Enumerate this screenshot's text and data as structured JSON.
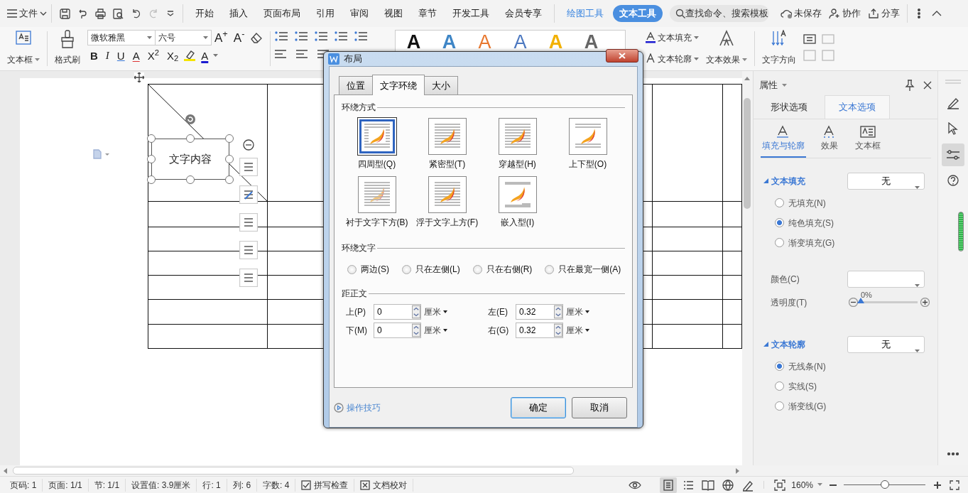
{
  "top_bar": {
    "menu_label": "文件",
    "tabs": [
      {
        "label": "开始",
        "kind": "normal",
        "selected": false
      },
      {
        "label": "插入",
        "kind": "normal",
        "selected": false
      },
      {
        "label": "页面布局",
        "kind": "normal",
        "selected": false
      },
      {
        "label": "引用",
        "kind": "normal",
        "selected": false
      },
      {
        "label": "审阅",
        "kind": "normal",
        "selected": false
      },
      {
        "label": "视图",
        "kind": "normal",
        "selected": false
      },
      {
        "label": "章节",
        "kind": "normal",
        "selected": false
      },
      {
        "label": "开发工具",
        "kind": "normal",
        "selected": false
      },
      {
        "label": "会员专享",
        "kind": "normal",
        "selected": false
      },
      {
        "label": "绘图工具",
        "kind": "context",
        "selected": false
      },
      {
        "label": "文本工具",
        "kind": "context",
        "selected": true
      }
    ],
    "search": {
      "placeholder": "查找命令、搜索模板"
    },
    "actions": [
      "未保存",
      "协作",
      "分享"
    ]
  },
  "ribbon": {
    "text_box": "文本框",
    "format_painter": "格式刷",
    "font_name": "微软雅黑",
    "font_size": "六号",
    "size_buttons": [
      "A$^{+}$",
      "A$^{-}$"
    ],
    "format_buttons": [
      {
        "label": "B",
        "kind": "bold"
      },
      {
        "label": "I",
        "kind": "italic"
      },
      {
        "label": "U",
        "kind": "underline"
      },
      {
        "label": "A",
        "kind": "strike"
      },
      {
        "label": "X$^{2}$",
        "kind": "plain"
      },
      {
        "label": "X$_{2}$",
        "kind": "plain"
      }
    ],
    "font_color": "A",
    "styles": [
      {
        "label": "A",
        "kind": "solid",
        "color": "#111111"
      },
      {
        "label": "A",
        "kind": "solid",
        "color": "#3f86c6"
      },
      {
        "label": "A",
        "kind": "outline",
        "color": "#e8772e"
      },
      {
        "label": "A",
        "kind": "outline",
        "color": "#4c78c0"
      },
      {
        "label": "A",
        "kind": "solid",
        "color": "#f2b100"
      },
      {
        "label": "A",
        "kind": "solid",
        "color": "#666666"
      }
    ],
    "text_fill": "文本填充",
    "text_outline": "文本轮廓",
    "text_effect": "文本效果",
    "text_direction": "文字方向"
  },
  "document": {
    "text_box": "文字内容"
  },
  "dialog": {
    "title": "布局",
    "tabs": [
      {
        "label": "位置",
        "selected": false
      },
      {
        "label": "文字环绕",
        "selected": true
      },
      {
        "label": "大小",
        "selected": false
      }
    ],
    "wrap_heading": "环绕方式",
    "wrap_styles": [
      {
        "label": "四周型(Q)",
        "kind": "square",
        "selected": true
      },
      {
        "label": "紧密型(T)",
        "kind": "tight",
        "selected": false
      },
      {
        "label": "穿越型(H)",
        "kind": "through",
        "selected": false
      },
      {
        "label": "上下型(O)",
        "kind": "topbottom",
        "selected": false
      },
      {
        "label": "衬于文字下方(B)",
        "kind": "behind",
        "selected": false
      },
      {
        "label": "浮于文字上方(F)",
        "kind": "front",
        "selected": false
      },
      {
        "label": "嵌入型(I)",
        "kind": "inline",
        "selected": false
      }
    ],
    "wrap_text_heading": "环绕文字",
    "wrap_sides": [
      {
        "label": "两边(S)",
        "checked": false
      },
      {
        "label": "只在左侧(L)",
        "checked": false
      },
      {
        "label": "只在右侧(R)",
        "checked": false
      },
      {
        "label": "只在最宽一侧(A)",
        "checked": false
      }
    ],
    "distance_heading": "距正文",
    "distances": [
      {
        "label": "上(P)",
        "value": "0",
        "unit": "厘米"
      },
      {
        "label": "左(E)",
        "value": "0.32",
        "unit": "厘米"
      },
      {
        "label": "下(M)",
        "value": "0",
        "unit": "厘米"
      },
      {
        "label": "右(G)",
        "value": "0.32",
        "unit": "厘米"
      }
    ],
    "tips": "操作技巧",
    "buttons": [
      "确定",
      "取消"
    ]
  },
  "panel": {
    "title": "属性",
    "tabs": [
      {
        "label": "形状选项",
        "selected": false
      },
      {
        "label": "文本选项",
        "selected": true
      }
    ],
    "subtabs": [
      {
        "label": "填充与轮廓",
        "kind": "fill",
        "selected": true
      },
      {
        "label": "效果",
        "kind": "effect",
        "selected": false
      },
      {
        "label": "文本框",
        "kind": "box",
        "selected": false
      }
    ],
    "fill": {
      "heading": "文本填充",
      "value": "无",
      "options": [
        {
          "label": "无填充(N)",
          "checked": false
        },
        {
          "label": "纯色填充(S)",
          "checked": true
        },
        {
          "label": "渐变填充(G)",
          "checked": false
        }
      ],
      "color_label": "颜色(C)",
      "transparency_label": "透明度(T)",
      "transparency_reading": "0%",
      "transparency": {
        "level": 0
      }
    },
    "outline": {
      "heading": "文本轮廓",
      "value": "无",
      "options": [
        {
          "label": "无线条(N)",
          "checked": true
        },
        {
          "label": "实线(S)",
          "checked": false
        },
        {
          "label": "渐变线(G)",
          "checked": false
        }
      ]
    }
  },
  "status_bar": {
    "items": [
      "页码: 1",
      "页面: 1/1",
      "节: 1/1",
      "设置值: 3.9厘米",
      "行: 1",
      "列: 6",
      "字数: 4"
    ],
    "tools": [
      "拼写检查",
      "文档校对"
    ],
    "views": [
      {
        "kind": "page",
        "selected": true
      },
      {
        "kind": "outline",
        "selected": false
      },
      {
        "kind": "read",
        "selected": false
      },
      {
        "kind": "web",
        "selected": false
      },
      {
        "kind": "write",
        "selected": false
      }
    ],
    "zoom": "160%",
    "zoom_slider": {
      "level": 0.5
    }
  }
}
